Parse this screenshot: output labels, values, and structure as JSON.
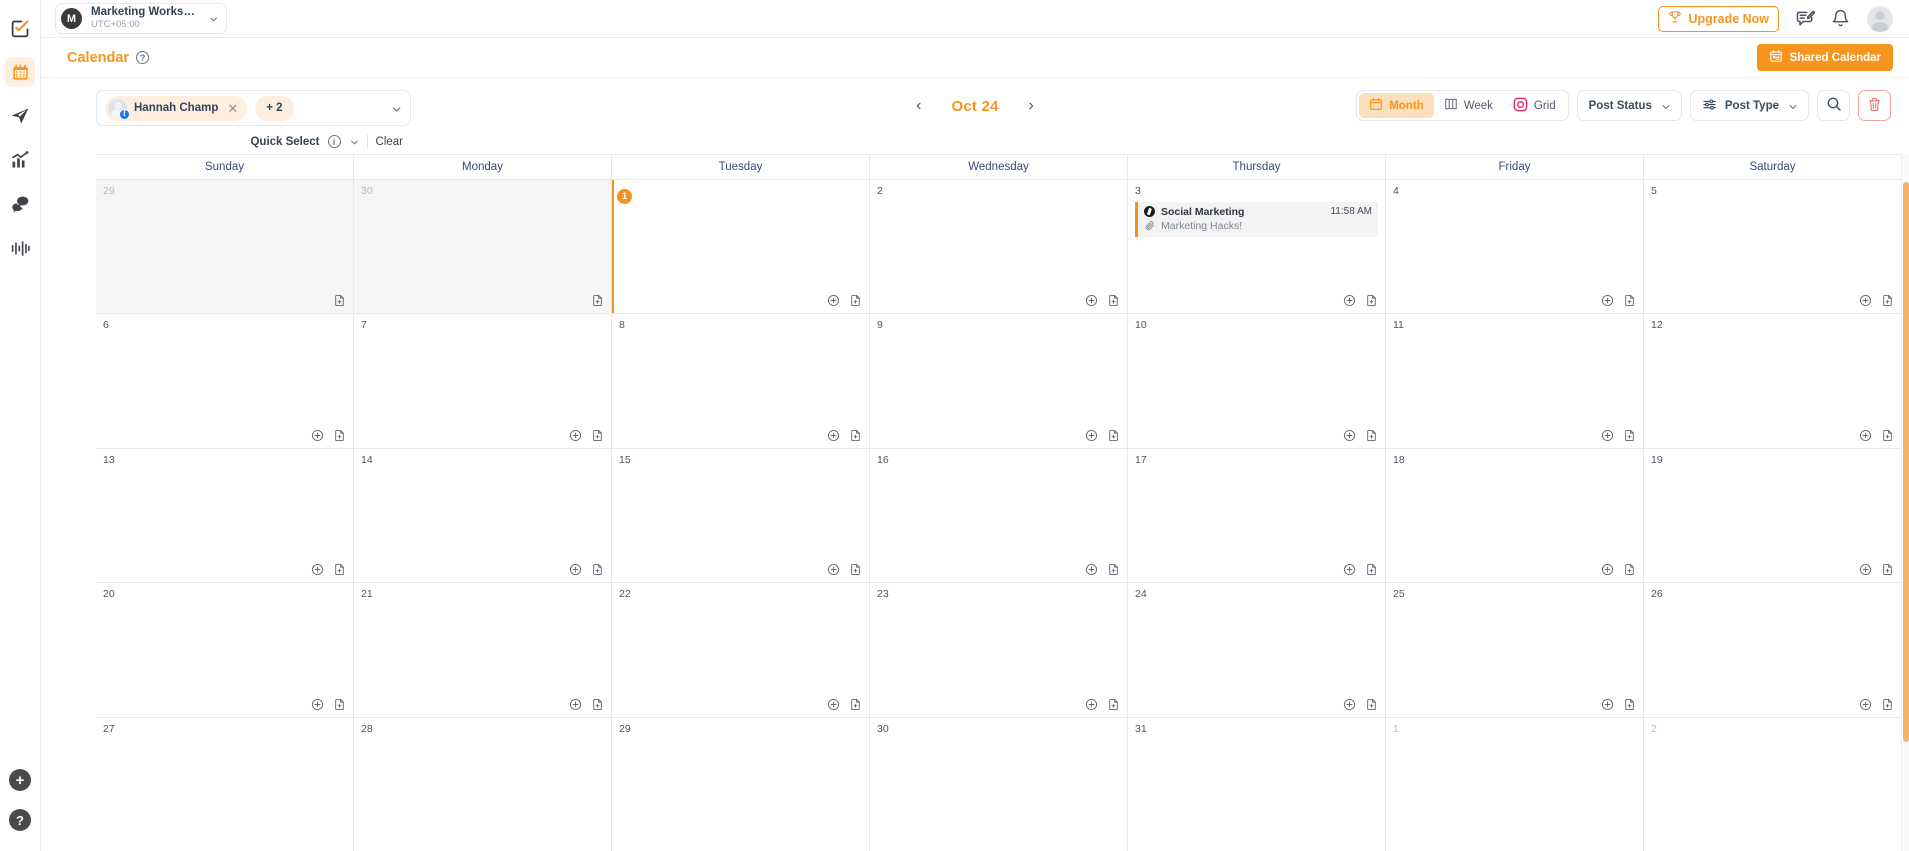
{
  "rail": {
    "items": [
      {
        "name": "publish-icon",
        "icon": "check-square-pencil",
        "active": false
      },
      {
        "name": "calendar-icon",
        "icon": "calendar",
        "active": true
      },
      {
        "name": "engage-icon",
        "icon": "paper-plane",
        "active": false
      },
      {
        "name": "analytics-icon",
        "icon": "bar-chart-trend",
        "active": false
      },
      {
        "name": "inbox-icon",
        "icon": "chat-bubbles",
        "active": false
      },
      {
        "name": "listening-icon",
        "icon": "audio-waveform",
        "active": false
      }
    ],
    "add_label": "+",
    "help_label": "?"
  },
  "topbar": {
    "workspace": {
      "avatar_letter": "M",
      "name": "Marketing Workspa...",
      "timezone": "UTC+05:00"
    },
    "upgrade_label": "Upgrade Now",
    "icons": [
      {
        "name": "compose-icon"
      },
      {
        "name": "notification-bell-icon"
      }
    ],
    "avatar_name": "user-avatar"
  },
  "header": {
    "title": "Calendar",
    "help_label": "?",
    "shared_calendar_label": "Shared Calendar"
  },
  "toolbar": {
    "profile_chip": {
      "label": "Hannah Champ",
      "network": "facebook",
      "network_glyph": "f",
      "remove_label": "✕"
    },
    "more_count_label": "+ 2",
    "quick_select_label": "Quick Select",
    "quick_select_info": "i",
    "clear_label": "Clear",
    "date_label": "Oct 24",
    "prev_label": "‹",
    "next_label": "›",
    "views": [
      {
        "label": "Month",
        "icon": "calendar-icon",
        "active": true
      },
      {
        "label": "Week",
        "icon": "columns-icon",
        "active": false
      },
      {
        "label": "Grid",
        "icon": "instagram-icon",
        "active": false
      }
    ],
    "post_status_label": "Post Status",
    "post_type_label": "Post Type",
    "search_name": "search-icon",
    "delete_name": "trash-icon"
  },
  "calendar": {
    "weekdays": [
      "Sunday",
      "Monday",
      "Tuesday",
      "Wednesday",
      "Thursday",
      "Friday",
      "Saturday"
    ],
    "add_post_icon": "plus-circle-icon",
    "add_draft_icon": "file-plus-icon",
    "weeks": [
      [
        {
          "day": "29",
          "muted": true,
          "shaded": true,
          "actions": [
            "file-plus-icon"
          ]
        },
        {
          "day": "30",
          "muted": true,
          "shaded": true,
          "actions": [
            "file-plus-icon"
          ]
        },
        {
          "day": "1",
          "badge": true,
          "today_col": true,
          "actions": [
            "plus-circle-icon",
            "file-plus-icon"
          ]
        },
        {
          "day": "2",
          "actions": [
            "plus-circle-icon",
            "file-plus-icon"
          ]
        },
        {
          "day": "3",
          "actions": [
            "plus-circle-icon",
            "file-plus-icon"
          ],
          "events": [
            {
              "network": "tiktok",
              "title": "Social Marketing",
              "time": "11:58 AM",
              "subtitle": "Marketing Hacks!"
            }
          ]
        },
        {
          "day": "4",
          "actions": [
            "plus-circle-icon",
            "file-plus-icon"
          ]
        },
        {
          "day": "5",
          "actions": [
            "plus-circle-icon",
            "file-plus-icon"
          ]
        }
      ],
      [
        {
          "day": "6",
          "actions": [
            "plus-circle-icon",
            "file-plus-icon"
          ]
        },
        {
          "day": "7",
          "actions": [
            "plus-circle-icon",
            "file-plus-icon"
          ]
        },
        {
          "day": "8",
          "actions": [
            "plus-circle-icon",
            "file-plus-icon"
          ]
        },
        {
          "day": "9",
          "actions": [
            "plus-circle-icon",
            "file-plus-icon"
          ]
        },
        {
          "day": "10",
          "actions": [
            "plus-circle-icon",
            "file-plus-icon"
          ]
        },
        {
          "day": "11",
          "actions": [
            "plus-circle-icon",
            "file-plus-icon"
          ]
        },
        {
          "day": "12",
          "actions": [
            "plus-circle-icon",
            "file-plus-icon"
          ]
        }
      ],
      [
        {
          "day": "13",
          "actions": [
            "plus-circle-icon",
            "file-plus-icon"
          ]
        },
        {
          "day": "14",
          "actions": [
            "plus-circle-icon",
            "file-plus-icon"
          ]
        },
        {
          "day": "15",
          "actions": [
            "plus-circle-icon",
            "file-plus-icon"
          ]
        },
        {
          "day": "16",
          "actions": [
            "plus-circle-icon",
            "file-plus-icon"
          ]
        },
        {
          "day": "17",
          "actions": [
            "plus-circle-icon",
            "file-plus-icon"
          ]
        },
        {
          "day": "18",
          "actions": [
            "plus-circle-icon",
            "file-plus-icon"
          ]
        },
        {
          "day": "19",
          "actions": [
            "plus-circle-icon",
            "file-plus-icon"
          ]
        }
      ],
      [
        {
          "day": "20",
          "actions": [
            "plus-circle-icon",
            "file-plus-icon"
          ]
        },
        {
          "day": "21",
          "actions": [
            "plus-circle-icon",
            "file-plus-icon"
          ]
        },
        {
          "day": "22",
          "actions": [
            "plus-circle-icon",
            "file-plus-icon"
          ]
        },
        {
          "day": "23",
          "actions": [
            "plus-circle-icon",
            "file-plus-icon"
          ]
        },
        {
          "day": "24",
          "actions": [
            "plus-circle-icon",
            "file-plus-icon"
          ]
        },
        {
          "day": "25",
          "actions": [
            "plus-circle-icon",
            "file-plus-icon"
          ]
        },
        {
          "day": "26",
          "actions": [
            "plus-circle-icon",
            "file-plus-icon"
          ]
        }
      ],
      [
        {
          "day": "27",
          "actions": []
        },
        {
          "day": "28",
          "actions": []
        },
        {
          "day": "29",
          "actions": []
        },
        {
          "day": "30",
          "actions": []
        },
        {
          "day": "31",
          "actions": []
        },
        {
          "day": "1",
          "muted": true,
          "actions": []
        },
        {
          "day": "2",
          "muted": true,
          "actions": []
        }
      ]
    ]
  },
  "colors": {
    "accent": "#f7941e",
    "accent_soft": "#fdeee0",
    "text": "#3d4a5c",
    "muted": "#b6babf",
    "border": "#e6e8eb",
    "event_bg": "#f3f3f4",
    "danger": "#f3a7a0",
    "instagram": "#e1306c",
    "facebook": "#1877f2"
  }
}
